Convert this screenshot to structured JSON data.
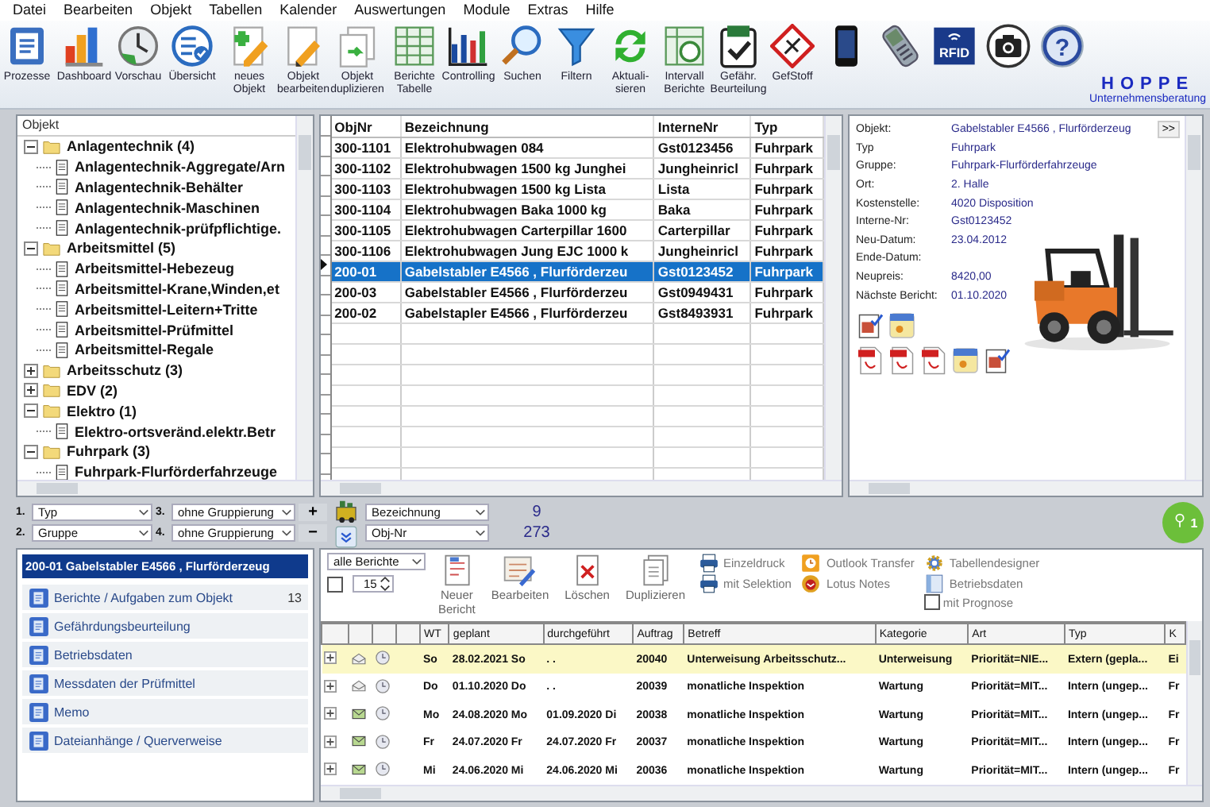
{
  "menu": [
    "Datei",
    "Bearbeiten",
    "Objekt",
    "Tabellen",
    "Kalender",
    "Auswertungen",
    "Module",
    "Extras",
    "Hilfe"
  ],
  "toolbar": [
    {
      "kind": "processes",
      "lines": [
        "Prozesse"
      ]
    },
    {
      "kind": "dashboard",
      "lines": [
        "Dashboard"
      ]
    },
    {
      "kind": "preview",
      "lines": [
        "Vorschau"
      ]
    },
    {
      "kind": "overview",
      "lines": [
        "Übersicht"
      ]
    },
    {
      "kind": "new",
      "lines": [
        "neues",
        "Objekt"
      ]
    },
    {
      "kind": "edit",
      "lines": [
        "Objekt",
        "bearbeiten"
      ]
    },
    {
      "kind": "duplicate",
      "lines": [
        "Objekt",
        "duplizieren"
      ]
    },
    {
      "kind": "reports",
      "lines": [
        "Berichte",
        "Tabelle"
      ]
    },
    {
      "kind": "controlling",
      "lines": [
        "Controlling"
      ]
    },
    {
      "kind": "search",
      "lines": [
        "Suchen"
      ]
    },
    {
      "kind": "filter",
      "lines": [
        "Filtern"
      ]
    },
    {
      "kind": "refresh",
      "lines": [
        "Aktuali-",
        "sieren"
      ]
    },
    {
      "kind": "interval",
      "lines": [
        "Intervall",
        "Berichte"
      ]
    },
    {
      "kind": "assessment",
      "lines": [
        "Gefähr.",
        "Beurteilung"
      ]
    },
    {
      "kind": "hazard",
      "lines": [
        "GefStoff"
      ]
    },
    {
      "kind": "phone"
    },
    {
      "kind": "handheld"
    },
    {
      "kind": "rfid",
      "icon_text": "RFID"
    },
    {
      "kind": "camera"
    },
    {
      "kind": "help",
      "icon_text": "?"
    }
  ],
  "logo": {
    "title": "HOPPE",
    "subtitle": "Unternehmensberatung"
  },
  "tree": {
    "header": "Objekt",
    "items": [
      {
        "kind": "folder",
        "label": "Anlagentechnik  (4)",
        "expanded": true,
        "children": [
          {
            "kind": "document",
            "label": "Anlagentechnik-Aggregate/Arn"
          },
          {
            "kind": "document",
            "label": "Anlagentechnik-Behälter"
          },
          {
            "kind": "document",
            "label": "Anlagentechnik-Maschinen"
          },
          {
            "kind": "document",
            "label": "Anlagentechnik-prüfpflichtige."
          }
        ]
      },
      {
        "kind": "folder",
        "label": "Arbeitsmittel  (5)",
        "expanded": true,
        "children": [
          {
            "kind": "document",
            "label": "Arbeitsmittel-Hebezeug"
          },
          {
            "kind": "document",
            "label": "Arbeitsmittel-Krane,Winden,et"
          },
          {
            "kind": "document",
            "label": "Arbeitsmittel-Leitern+Tritte"
          },
          {
            "kind": "document",
            "label": "Arbeitsmittel-Prüfmittel"
          },
          {
            "kind": "document",
            "label": "Arbeitsmittel-Regale"
          }
        ]
      },
      {
        "kind": "folder",
        "label": "Arbeitsschutz  (3)",
        "expanded": false
      },
      {
        "kind": "folder",
        "label": "EDV  (2)",
        "expanded": false
      },
      {
        "kind": "folder",
        "label": "Elektro  (1)",
        "expanded": true,
        "children": [
          {
            "kind": "document",
            "label": "Elektro-ortsveränd.elektr.Betr"
          }
        ]
      },
      {
        "kind": "folder",
        "label": "Fuhrpark  (3)",
        "expanded": true,
        "children": [
          {
            "kind": "document",
            "label": "Fuhrpark-Flurförderfahrzeuge"
          }
        ]
      }
    ]
  },
  "objects": {
    "columns": [
      "ObjNr",
      "Bezeichnung",
      "InterneNr",
      "Typ"
    ],
    "rows": [
      {
        "cells": [
          "300-1101",
          "Elektrohubwagen 084",
          "Gst0123456",
          "Fuhrpark"
        ],
        "selected": false
      },
      {
        "cells": [
          "300-1102",
          "Elektrohubwagen 1500 kg  Junghei",
          "Jungheinricl",
          "Fuhrpark"
        ],
        "selected": false
      },
      {
        "cells": [
          "300-1103",
          "Elektrohubwagen 1500 kg Lista",
          "Lista",
          "Fuhrpark"
        ],
        "selected": false
      },
      {
        "cells": [
          "300-1104",
          "Elektrohubwagen Baka 1000 kg",
          "Baka",
          "Fuhrpark"
        ],
        "selected": false
      },
      {
        "cells": [
          "300-1105",
          "Elektrohubwagen Carterpillar 1600",
          "Carterpillar",
          "Fuhrpark"
        ],
        "selected": false
      },
      {
        "cells": [
          "300-1106",
          "Elektrohubwagen Jung EJC 1000 k",
          "Jungheinricl",
          "Fuhrpark"
        ],
        "selected": false
      },
      {
        "cells": [
          "200-01",
          "Gabelstabler E4566 , Flurförderzeu",
          "Gst0123452",
          "Fuhrpark"
        ],
        "selected": true
      },
      {
        "cells": [
          "200-03",
          "Gabelstabler E4566 , Flurförderzeu",
          "Gst0949431",
          "Fuhrpark"
        ],
        "selected": false
      },
      {
        "cells": [
          "200-02",
          "Gabelstapler E4566 , Flurförderzeu",
          "Gst8493931",
          "Fuhrpark"
        ],
        "selected": false
      }
    ]
  },
  "details": {
    "more_button": ">>",
    "fields": [
      {
        "label": "Objekt:",
        "value": "Gabelstabler E4566 , Flurförderzeug"
      },
      {
        "label": "Typ",
        "value": "Fuhrpark"
      },
      {
        "label": "Gruppe:",
        "value": "Fuhrpark-Flurförderfahrzeuge"
      },
      {
        "label": "Ort:",
        "value": "2. Halle"
      },
      {
        "label": "Kostenstelle:",
        "value": "4020 Disposition"
      },
      {
        "label": "Interne-Nr:",
        "value": "Gst0123452"
      },
      {
        "label": "Neu-Datum:",
        "value": "23.04.2012"
      },
      {
        "label": "Ende-Datum:"
      },
      {
        "label": "Neupreis:",
        "value": "8420,00"
      },
      {
        "label": "Nächste Bericht:",
        "value": "01.10.2020"
      }
    ]
  },
  "grouping": {
    "levels": [
      {
        "number": "1.",
        "value": "Typ"
      },
      {
        "number": "3.",
        "value": "ohne Gruppierung"
      },
      {
        "number": "2.",
        "value": "Gruppe"
      },
      {
        "number": "4.",
        "value": "ohne Gruppierung"
      }
    ],
    "add": "+",
    "remove": "−",
    "sorts": [
      {
        "value": "Bezeichnung",
        "count": "9"
      },
      {
        "value": "Obj-Nr",
        "count": "273"
      }
    ],
    "badge": "1"
  },
  "object_panel": {
    "title": "200-01 Gabelstabler E4566 , Flurförderzeug",
    "items": [
      {
        "label": "Berichte / Aufgaben zum Objekt",
        "count": "13"
      },
      {
        "label": "Gefährdungsbeurteilung"
      },
      {
        "label": "Betriebsdaten"
      },
      {
        "label": "Messdaten der Prüfmittel"
      },
      {
        "label": "Memo"
      },
      {
        "label": "Dateianhänge / Querverweise"
      }
    ]
  },
  "reports": {
    "filter": "alle Berichte",
    "limit_checked": false,
    "limit": "15",
    "actions": [
      {
        "lines": [
          "Neuer",
          "Bericht"
        ]
      },
      {
        "lines": [
          "Bearbeiten"
        ]
      },
      {
        "lines": [
          "Löschen"
        ]
      },
      {
        "lines": [
          "Duplizieren"
        ]
      }
    ],
    "links": [
      "Einzeldruck",
      "mit Selektion",
      "Outlook Transfer",
      "Lotus Notes",
      "Tabellendesigner",
      "Betriebsdaten"
    ],
    "forecast": {
      "label": "mit Prognose",
      "checked": false
    },
    "columns": [
      "WT",
      "geplant",
      "durchgeführt",
      "Auftrag",
      "Betreff",
      "Kategorie",
      "Art",
      "Typ",
      "K"
    ],
    "rows": [
      {
        "selected": true,
        "sent": false,
        "cells": [
          "So",
          "28.02.2021 So",
          ". .",
          "20040",
          "Unterweisung Arbeitsschutz...",
          "Unterweisung",
          "Priorität=NIE...",
          "Extern (gepla...",
          "Ei"
        ]
      },
      {
        "selected": false,
        "sent": false,
        "cells": [
          "Do",
          "01.10.2020 Do",
          ". .",
          "20039",
          "monatliche Inspektion",
          "Wartung",
          "Priorität=MIT...",
          "Intern (ungep...",
          "Fr"
        ]
      },
      {
        "selected": false,
        "sent": true,
        "cells": [
          "Mo",
          "24.08.2020 Mo",
          "01.09.2020 Di",
          "20038",
          "monatliche Inspektion",
          "Wartung",
          "Priorität=MIT...",
          "Intern (ungep...",
          "Fr"
        ]
      },
      {
        "selected": false,
        "sent": true,
        "cells": [
          "Fr",
          "24.07.2020 Fr",
          "24.07.2020 Fr",
          "20037",
          "monatliche Inspektion",
          "Wartung",
          "Priorität=MIT...",
          "Intern (ungep...",
          "Fr"
        ]
      },
      {
        "selected": false,
        "sent": true,
        "cells": [
          "Mi",
          "24.06.2020 Mi",
          "24.06.2020 Mi",
          "20036",
          "monatliche Inspektion",
          "Wartung",
          "Priorität=MIT...",
          "Intern (ungep...",
          "Fr"
        ]
      }
    ]
  }
}
